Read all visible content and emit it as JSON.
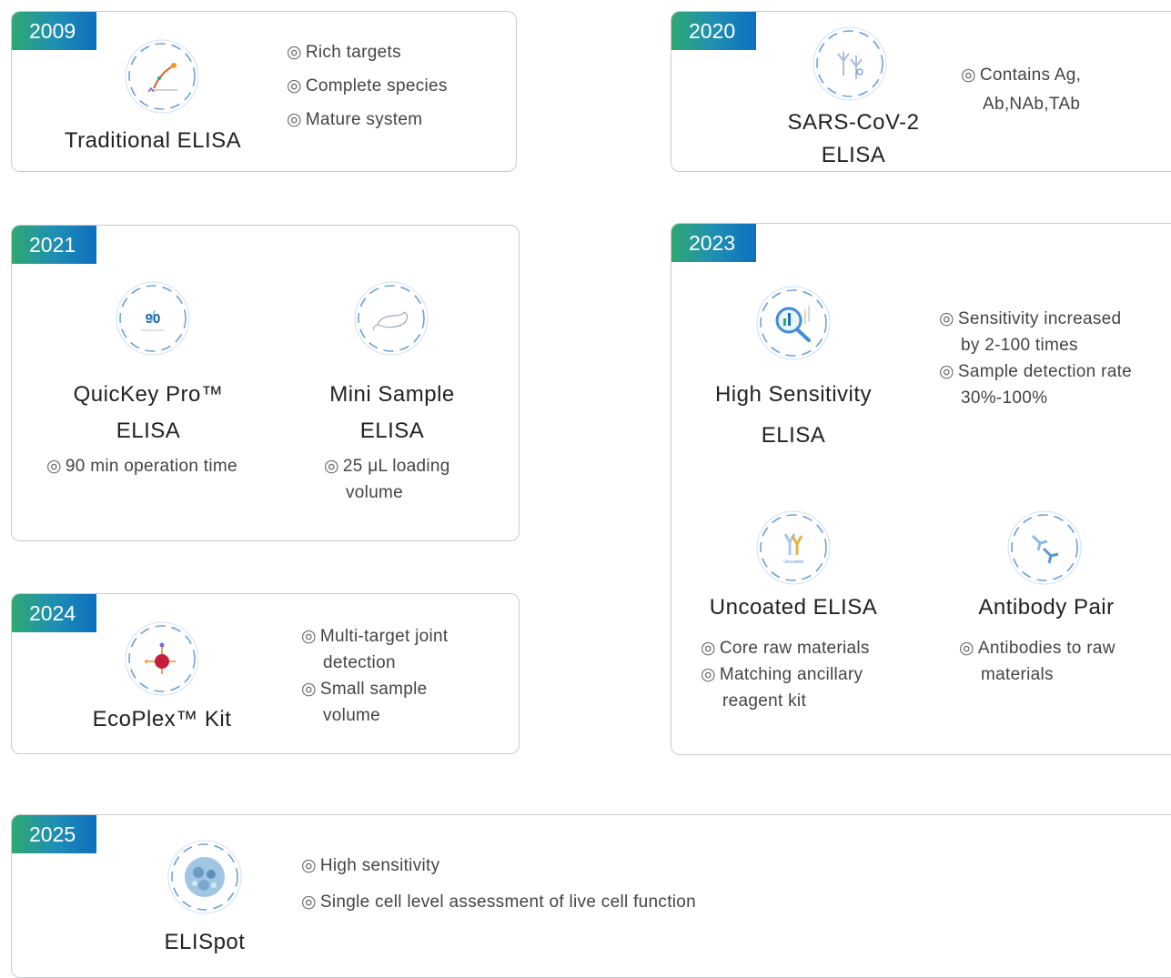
{
  "bullet": "◎",
  "cards": {
    "c2009": {
      "year": "2009",
      "title": "Traditional ELISA",
      "features": [
        "Rich targets",
        "Complete species",
        "Mature system"
      ]
    },
    "c2020": {
      "year": "2020",
      "title_line1": "SARS-CoV-2",
      "title_line2": "ELISA",
      "feature_line1": "Contains Ag,",
      "feature_line2": "Ab,NAb,TAb"
    },
    "c2021": {
      "year": "2021",
      "icon_text": "90",
      "p1": {
        "title_line1": "QuicKey Pro™",
        "title_line2": "ELISA",
        "feature": "90 min operation time"
      },
      "p2": {
        "title_line1": "Mini Sample",
        "title_line2": "ELISA",
        "feature_line1": "25 μL loading",
        "feature_line2": "volume"
      }
    },
    "c2023": {
      "year": "2023",
      "p1": {
        "title_line1": "High Sensitivity",
        "title_line2": "ELISA",
        "f1_line1": "Sensitivity increased",
        "f1_line2": "by 2-100 times",
        "f2_line1": "Sample detection rate",
        "f2_line2": "30%-100%"
      },
      "p2": {
        "title": "Uncoated ELISA",
        "icon_text": "Uncoated",
        "f1": "Core raw materials",
        "f2_line1": "Matching ancillary",
        "f2_line2": "reagent kit"
      },
      "p3": {
        "title": "Antibody Pair",
        "f1_line1": "Antibodies to raw",
        "f1_line2": "materials"
      }
    },
    "c2024": {
      "year": "2024",
      "title": "EcoPlex™ Kit",
      "f1_line1": "Multi-target joint",
      "f1_line2": "detection",
      "f2_line1": "Small sample",
      "f2_line2": "volume"
    },
    "c2025": {
      "year": "2025",
      "title": "ELISpot",
      "features": [
        "High sensitivity",
        "Single cell level assessment of live cell function"
      ]
    }
  },
  "colors": {
    "accent_blue": "#1a6fc0",
    "accent_green": "#2ea972",
    "ring": "#6a9fd8"
  }
}
